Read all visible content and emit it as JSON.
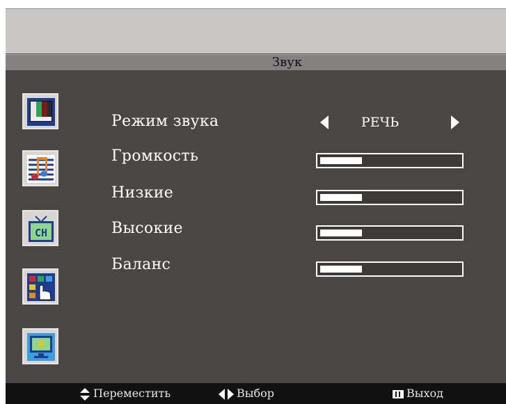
{
  "menu": {
    "title": "Звук",
    "icons": [
      "picture-icon",
      "sound-icon",
      "channel-icon",
      "function-icon",
      "display-icon"
    ],
    "items": [
      {
        "label": "Режим звука",
        "type": "selector",
        "value": "РЕЧЬ"
      },
      {
        "label": "Громкость",
        "type": "slider",
        "level": 0.3
      },
      {
        "label": "Низкие",
        "type": "slider",
        "level": 0.3
      },
      {
        "label": "Высокие",
        "type": "slider",
        "level": 0.3
      },
      {
        "label": "Баланс",
        "type": "slider",
        "level": 0.3
      }
    ]
  },
  "footer": {
    "move": "Переместить",
    "select": "Выбор",
    "exit": "Выход"
  },
  "colors": {
    "panel": "#4a4644",
    "title_bar": "#858180",
    "top_band": "#c9c6c4",
    "footer": "#111111",
    "text": "#ffffff"
  }
}
